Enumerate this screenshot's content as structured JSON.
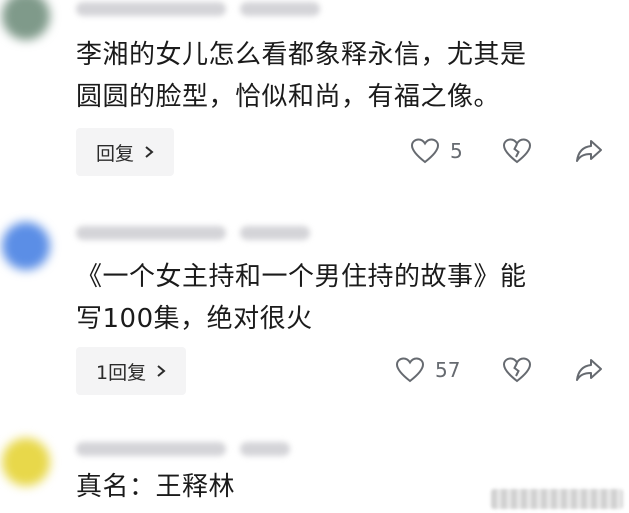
{
  "comments": [
    {
      "text": "李湘的女儿怎么看都象释永信，尤其是\n圆圆的脸型，恰似和尚，有福之像。",
      "reply_label": "回复",
      "like_count": "5",
      "avatar_color": "#7f9a8a"
    },
    {
      "text": "《一个女主持和一个男住持的故事》能\n写100集，绝对很火",
      "reply_label": "1回复",
      "like_count": "57",
      "avatar_color": "#5b8ee6"
    },
    {
      "text": "真名：王释林",
      "avatar_color": "#e8d84a"
    }
  ],
  "colors": {
    "reply_bg": "#f4f4f5",
    "icon": "#666a70"
  },
  "icons": [
    "heart-icon",
    "broken-heart-icon",
    "share-icon",
    "chevron-right-icon"
  ]
}
